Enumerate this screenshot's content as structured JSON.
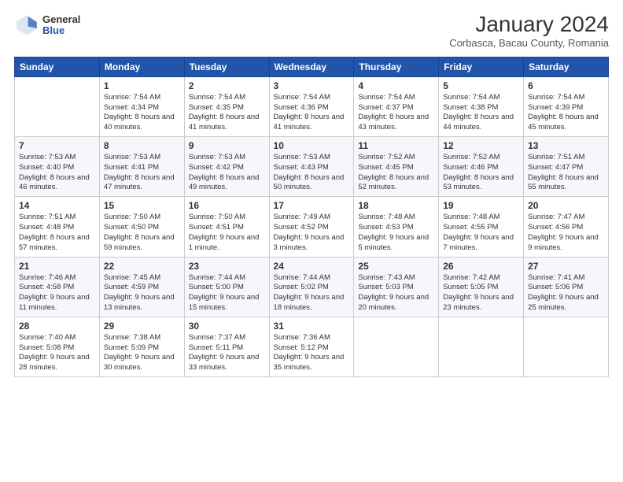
{
  "logo": {
    "general": "General",
    "blue": "Blue"
  },
  "title": "January 2024",
  "subtitle": "Corbasca, Bacau County, Romania",
  "days": [
    "Sunday",
    "Monday",
    "Tuesday",
    "Wednesday",
    "Thursday",
    "Friday",
    "Saturday"
  ],
  "weeks": [
    [
      {
        "date": "",
        "sunrise": "",
        "sunset": "",
        "daylight": ""
      },
      {
        "date": "1",
        "sunrise": "Sunrise: 7:54 AM",
        "sunset": "Sunset: 4:34 PM",
        "daylight": "Daylight: 8 hours and 40 minutes."
      },
      {
        "date": "2",
        "sunrise": "Sunrise: 7:54 AM",
        "sunset": "Sunset: 4:35 PM",
        "daylight": "Daylight: 8 hours and 41 minutes."
      },
      {
        "date": "3",
        "sunrise": "Sunrise: 7:54 AM",
        "sunset": "Sunset: 4:36 PM",
        "daylight": "Daylight: 8 hours and 41 minutes."
      },
      {
        "date": "4",
        "sunrise": "Sunrise: 7:54 AM",
        "sunset": "Sunset: 4:37 PM",
        "daylight": "Daylight: 8 hours and 43 minutes."
      },
      {
        "date": "5",
        "sunrise": "Sunrise: 7:54 AM",
        "sunset": "Sunset: 4:38 PM",
        "daylight": "Daylight: 8 hours and 44 minutes."
      },
      {
        "date": "6",
        "sunrise": "Sunrise: 7:54 AM",
        "sunset": "Sunset: 4:39 PM",
        "daylight": "Daylight: 8 hours and 45 minutes."
      }
    ],
    [
      {
        "date": "7",
        "sunrise": "Sunrise: 7:53 AM",
        "sunset": "Sunset: 4:40 PM",
        "daylight": "Daylight: 8 hours and 46 minutes."
      },
      {
        "date": "8",
        "sunrise": "Sunrise: 7:53 AM",
        "sunset": "Sunset: 4:41 PM",
        "daylight": "Daylight: 8 hours and 47 minutes."
      },
      {
        "date": "9",
        "sunrise": "Sunrise: 7:53 AM",
        "sunset": "Sunset: 4:42 PM",
        "daylight": "Daylight: 8 hours and 49 minutes."
      },
      {
        "date": "10",
        "sunrise": "Sunrise: 7:53 AM",
        "sunset": "Sunset: 4:43 PM",
        "daylight": "Daylight: 8 hours and 50 minutes."
      },
      {
        "date": "11",
        "sunrise": "Sunrise: 7:52 AM",
        "sunset": "Sunset: 4:45 PM",
        "daylight": "Daylight: 8 hours and 52 minutes."
      },
      {
        "date": "12",
        "sunrise": "Sunrise: 7:52 AM",
        "sunset": "Sunset: 4:46 PM",
        "daylight": "Daylight: 8 hours and 53 minutes."
      },
      {
        "date": "13",
        "sunrise": "Sunrise: 7:51 AM",
        "sunset": "Sunset: 4:47 PM",
        "daylight": "Daylight: 8 hours and 55 minutes."
      }
    ],
    [
      {
        "date": "14",
        "sunrise": "Sunrise: 7:51 AM",
        "sunset": "Sunset: 4:48 PM",
        "daylight": "Daylight: 8 hours and 57 minutes."
      },
      {
        "date": "15",
        "sunrise": "Sunrise: 7:50 AM",
        "sunset": "Sunset: 4:50 PM",
        "daylight": "Daylight: 8 hours and 59 minutes."
      },
      {
        "date": "16",
        "sunrise": "Sunrise: 7:50 AM",
        "sunset": "Sunset: 4:51 PM",
        "daylight": "Daylight: 9 hours and 1 minute."
      },
      {
        "date": "17",
        "sunrise": "Sunrise: 7:49 AM",
        "sunset": "Sunset: 4:52 PM",
        "daylight": "Daylight: 9 hours and 3 minutes."
      },
      {
        "date": "18",
        "sunrise": "Sunrise: 7:48 AM",
        "sunset": "Sunset: 4:53 PM",
        "daylight": "Daylight: 9 hours and 5 minutes."
      },
      {
        "date": "19",
        "sunrise": "Sunrise: 7:48 AM",
        "sunset": "Sunset: 4:55 PM",
        "daylight": "Daylight: 9 hours and 7 minutes."
      },
      {
        "date": "20",
        "sunrise": "Sunrise: 7:47 AM",
        "sunset": "Sunset: 4:56 PM",
        "daylight": "Daylight: 9 hours and 9 minutes."
      }
    ],
    [
      {
        "date": "21",
        "sunrise": "Sunrise: 7:46 AM",
        "sunset": "Sunset: 4:58 PM",
        "daylight": "Daylight: 9 hours and 11 minutes."
      },
      {
        "date": "22",
        "sunrise": "Sunrise: 7:45 AM",
        "sunset": "Sunset: 4:59 PM",
        "daylight": "Daylight: 9 hours and 13 minutes."
      },
      {
        "date": "23",
        "sunrise": "Sunrise: 7:44 AM",
        "sunset": "Sunset: 5:00 PM",
        "daylight": "Daylight: 9 hours and 15 minutes."
      },
      {
        "date": "24",
        "sunrise": "Sunrise: 7:44 AM",
        "sunset": "Sunset: 5:02 PM",
        "daylight": "Daylight: 9 hours and 18 minutes."
      },
      {
        "date": "25",
        "sunrise": "Sunrise: 7:43 AM",
        "sunset": "Sunset: 5:03 PM",
        "daylight": "Daylight: 9 hours and 20 minutes."
      },
      {
        "date": "26",
        "sunrise": "Sunrise: 7:42 AM",
        "sunset": "Sunset: 5:05 PM",
        "daylight": "Daylight: 9 hours and 23 minutes."
      },
      {
        "date": "27",
        "sunrise": "Sunrise: 7:41 AM",
        "sunset": "Sunset: 5:06 PM",
        "daylight": "Daylight: 9 hours and 25 minutes."
      }
    ],
    [
      {
        "date": "28",
        "sunrise": "Sunrise: 7:40 AM",
        "sunset": "Sunset: 5:08 PM",
        "daylight": "Daylight: 9 hours and 28 minutes."
      },
      {
        "date": "29",
        "sunrise": "Sunrise: 7:38 AM",
        "sunset": "Sunset: 5:09 PM",
        "daylight": "Daylight: 9 hours and 30 minutes."
      },
      {
        "date": "30",
        "sunrise": "Sunrise: 7:37 AM",
        "sunset": "Sunset: 5:11 PM",
        "daylight": "Daylight: 9 hours and 33 minutes."
      },
      {
        "date": "31",
        "sunrise": "Sunrise: 7:36 AM",
        "sunset": "Sunset: 5:12 PM",
        "daylight": "Daylight: 9 hours and 35 minutes."
      },
      {
        "date": "",
        "sunrise": "",
        "sunset": "",
        "daylight": ""
      },
      {
        "date": "",
        "sunrise": "",
        "sunset": "",
        "daylight": ""
      },
      {
        "date": "",
        "sunrise": "",
        "sunset": "",
        "daylight": ""
      }
    ]
  ]
}
